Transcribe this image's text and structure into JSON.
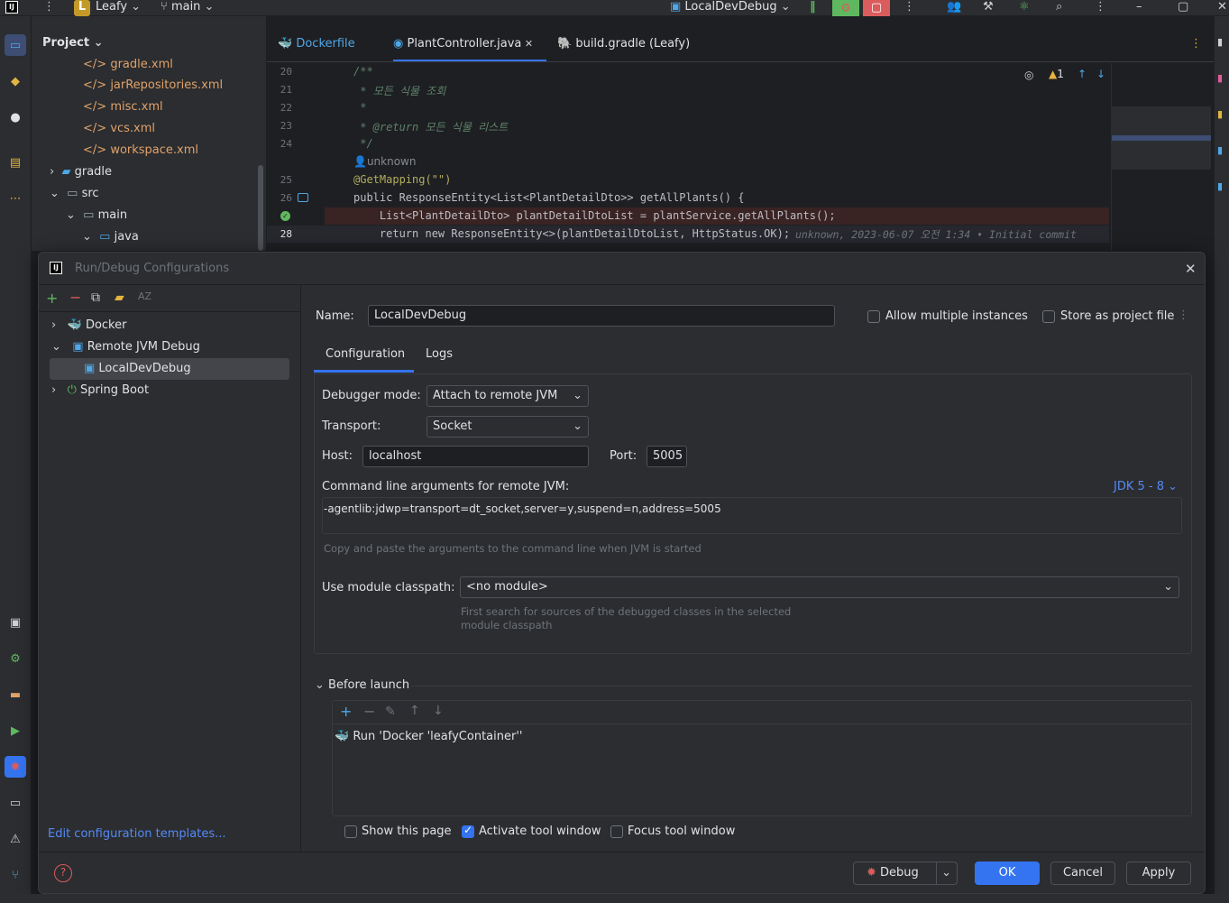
{
  "topbar": {
    "project_badge": "L",
    "project_name": "Leafy",
    "branch": "main",
    "run_config": "LocalDevDebug"
  },
  "project_panel": {
    "title": "Project",
    "items": [
      {
        "label": "gradle.xml",
        "type": "xml"
      },
      {
        "label": "jarRepositories.xml",
        "type": "xml"
      },
      {
        "label": "misc.xml",
        "type": "xml"
      },
      {
        "label": "vcs.xml",
        "type": "xml"
      },
      {
        "label": "workspace.xml",
        "type": "xml"
      },
      {
        "label": "gradle",
        "type": "folder"
      },
      {
        "label": "src",
        "type": "folder"
      },
      {
        "label": "main",
        "type": "folder"
      },
      {
        "label": "java",
        "type": "folder"
      }
    ]
  },
  "editor": {
    "tabs": [
      {
        "label": "Dockerfile"
      },
      {
        "label": "PlantController.java"
      },
      {
        "label": "build.gradle (Leafy)"
      }
    ],
    "warning_count": "1",
    "lines": [
      {
        "num": "20",
        "text": "/**"
      },
      {
        "num": "21",
        "text": " * 모든 식물 조회"
      },
      {
        "num": "22",
        "text": " *"
      },
      {
        "num": "23",
        "text": " * @return 모든 식물 리스트"
      },
      {
        "num": "24",
        "text": " */"
      },
      {
        "num": "",
        "text": "unknown"
      },
      {
        "num": "25",
        "text": "@GetMapping(\"\")"
      },
      {
        "num": "26",
        "text": "public ResponseEntity<List<PlantDetailDto>> getAllPlants() {"
      },
      {
        "num": "27",
        "text": "    List<PlantDetailDto> plantDetailDtoList = plantService.getAllPlants();"
      },
      {
        "num": "28",
        "text": "    return new ResponseEntity<>(plantDetailDtoList, HttpStatus.OK);"
      }
    ],
    "blame": "unknown, 2023-06-07 오전 1:34 • Initial commit"
  },
  "dialog": {
    "title": "Run/Debug Configurations",
    "tree": [
      {
        "label": "Docker"
      },
      {
        "label": "Remote JVM Debug"
      },
      {
        "label": "LocalDevDebug"
      },
      {
        "label": "Spring Boot"
      }
    ],
    "edit_templates": "Edit configuration templates...",
    "name_label": "Name:",
    "name_value": "LocalDevDebug",
    "allow_multiple": "Allow multiple instances",
    "store_project": "Store as project file",
    "tabs": [
      {
        "label": "Configuration"
      },
      {
        "label": "Logs"
      }
    ],
    "debugger_mode_label": "Debugger mode:",
    "debugger_mode_value": "Attach to remote JVM",
    "transport_label": "Transport:",
    "transport_value": "Socket",
    "host_label": "Host:",
    "host_value": "localhost",
    "port_label": "Port:",
    "port_value": "5005",
    "cmd_label": "Command line arguments for remote JVM:",
    "jdk_link": "JDK 5 - 8",
    "cmd_value": "-agentlib:jdwp=transport=dt_socket,server=y,suspend=n,address=5005",
    "cmd_hint": "Copy and paste the arguments to the command line when JVM is started",
    "module_label": "Use module classpath:",
    "module_value": "<no module>",
    "module_hint_1": "First search for sources of the debugged classes in the selected",
    "module_hint_2": "module classpath",
    "before_launch": "Before launch",
    "launch_task": "Run 'Docker 'leafyContainer''",
    "show_page": "Show this page",
    "activate_tool": "Activate tool window",
    "focus_tool": "Focus tool window",
    "debug_btn": "Debug",
    "ok_btn": "OK",
    "cancel_btn": "Cancel",
    "apply_btn": "Apply"
  },
  "colors": {
    "accent": "#3574f0",
    "xml_file": "#e0a26a",
    "link": "#548af7",
    "run_green": "#5fb85f",
    "stop_red": "#db5c5c"
  }
}
